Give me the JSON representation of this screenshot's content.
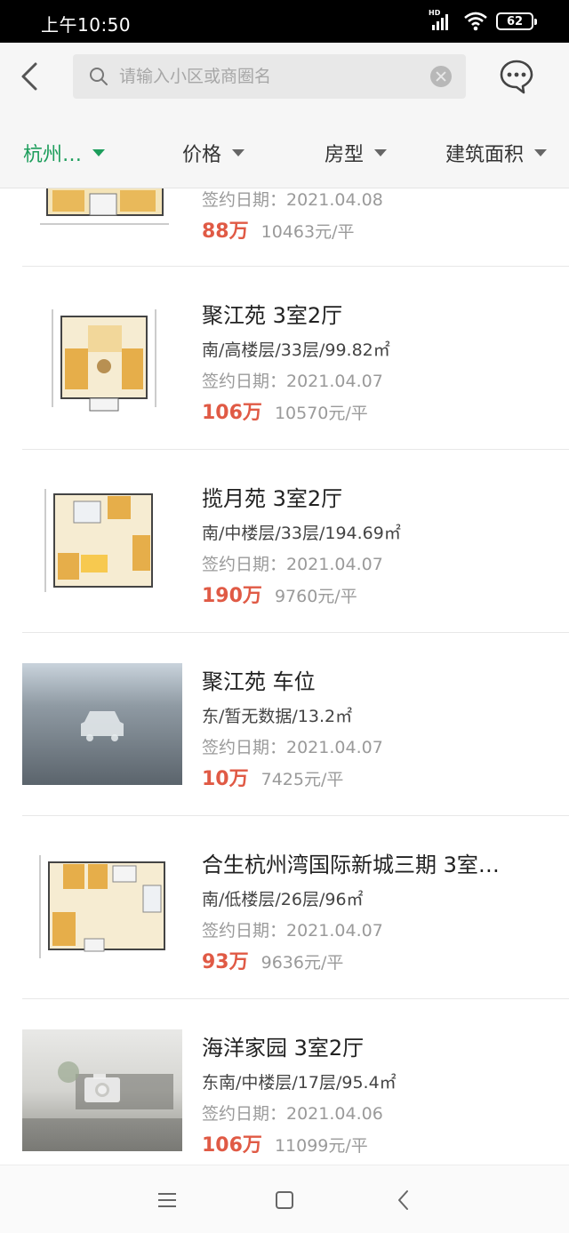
{
  "status_bar": {
    "time": "上午10:50",
    "network": "HD",
    "battery": "62"
  },
  "header": {
    "back_icon": "chevron-left-icon",
    "search": {
      "placeholder": "请输入小区或商圈名",
      "value": ""
    },
    "chat_icon": "chat-bubble-icon"
  },
  "filters": [
    {
      "label": "杭州…",
      "active": true
    },
    {
      "label": "价格",
      "active": false
    },
    {
      "label": "房型",
      "active": false
    },
    {
      "label": "建筑面积",
      "active": false
    }
  ],
  "listings": [
    {
      "title": "",
      "detail": "",
      "date": "签约日期：2021.04.08",
      "price": "88万",
      "unit_price": "10463元/平",
      "image": "floorplan"
    },
    {
      "title": "聚江苑 3室2厅",
      "detail": "南/高楼层/33层/99.82㎡",
      "date": "签约日期：2021.04.07",
      "price": "106万",
      "unit_price": "10570元/平",
      "image": "floorplan"
    },
    {
      "title": "揽月苑 3室2厅",
      "detail": "南/中楼层/33层/194.69㎡",
      "date": "签约日期：2021.04.07",
      "price": "190万",
      "unit_price": "9760元/平",
      "image": "floorplan"
    },
    {
      "title": "聚江苑 车位",
      "detail": "东/暂无数据/13.2㎡",
      "date": "签约日期：2021.04.07",
      "price": "10万",
      "unit_price": "7425元/平",
      "image": "parking-placeholder"
    },
    {
      "title": "合生杭州湾国际新城三期 3室…",
      "detail": "南/低楼层/26层/96㎡",
      "date": "签约日期：2021.04.07",
      "price": "93万",
      "unit_price": "9636元/平",
      "image": "floorplan"
    },
    {
      "title": "海洋家园 3室2厅",
      "detail": "东南/中楼层/17层/95.4㎡",
      "date": "签约日期：2021.04.06",
      "price": "106万",
      "unit_price": "11099元/平",
      "image": "camera-placeholder"
    }
  ],
  "nav_bar": {
    "menu_icon": "menu-icon",
    "home_icon": "square-home-icon",
    "back_icon": "triangle-back-icon"
  },
  "colors": {
    "accent": "#1c9d5b",
    "price": "#e05a45",
    "muted": "#9a9a9a"
  }
}
